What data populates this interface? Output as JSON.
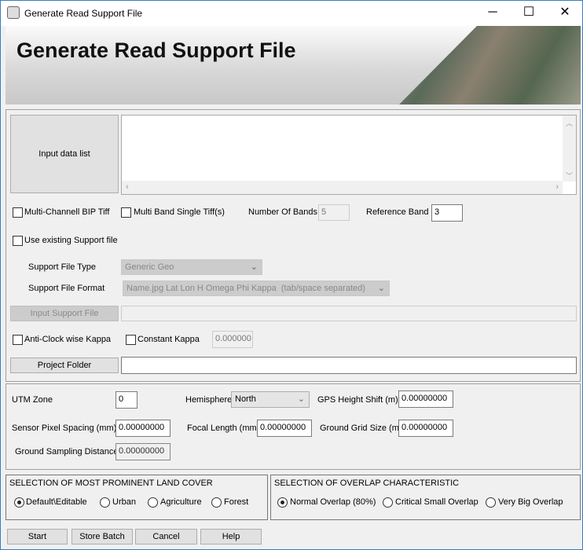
{
  "window": {
    "title": "Generate Read Support File",
    "minimize": "─",
    "maximize": "☐",
    "close": "✕"
  },
  "banner": {
    "title": "Generate Read Support File"
  },
  "input": {
    "data_list_button": "Input data list",
    "data_list_value": ""
  },
  "options": {
    "multi_channel_bip": {
      "label": "Multi-Channell BIP Tiff",
      "checked": false
    },
    "multi_band_single": {
      "label": "Multi Band Single Tiff(s)",
      "checked": false
    },
    "number_of_bands_label": "Number Of Bands",
    "number_of_bands": "5",
    "reference_band_label": "Reference Band",
    "reference_band": "3",
    "use_existing": {
      "label": "Use existing Support file",
      "checked": false
    },
    "support_file_type_label": "Support File Type",
    "support_file_type": "Generic Geo",
    "support_file_format_label": "Support File Format",
    "support_file_format": "Name.jpg Lat Lon H Omega Phi Kappa  (tab/space separated)",
    "input_support_file_button": "Input Support File",
    "input_support_file": "",
    "anticlock_kappa": {
      "label": "Anti-Clock wise Kappa",
      "checked": false
    },
    "constant_kappa": {
      "label": "Constant Kappa",
      "checked": false
    },
    "constant_kappa_value": "0.000000",
    "project_folder_button": "Project Folder",
    "project_folder": ""
  },
  "params": {
    "utm_zone_label": "UTM Zone",
    "utm_zone": "0",
    "hemisphere_label": "Hemisphere",
    "hemisphere": "North",
    "gps_height_label": "GPS Height Shift (m)",
    "gps_height": "0.00000000",
    "sensor_pixel_label": "Sensor Pixel Spacing (mm)",
    "sensor_pixel": "0.00000000",
    "focal_length_label": "Focal Length (mm)",
    "focal_length": "0.00000000",
    "ground_grid_label": "Ground Grid Size (m)",
    "ground_grid": "0.00000000",
    "gsd_label": "Ground Sampling Distance",
    "gsd": "0.00000000"
  },
  "land_cover": {
    "title": "SELECTION OF MOST PROMINENT LAND COVER",
    "options": [
      "Default\\Editable",
      "Urban",
      "Agriculture",
      "Forest"
    ],
    "selected": "Default\\Editable"
  },
  "overlap": {
    "title": "SELECTION OF OVERLAP CHARACTERISTIC",
    "options": [
      "Normal Overlap (80%)",
      "Critical Small Overlap",
      "Very Big Overlap"
    ],
    "selected": "Normal Overlap (80%)"
  },
  "buttons": {
    "start": "Start",
    "store_batch": "Store Batch",
    "cancel": "Cancel",
    "help": "Help"
  }
}
